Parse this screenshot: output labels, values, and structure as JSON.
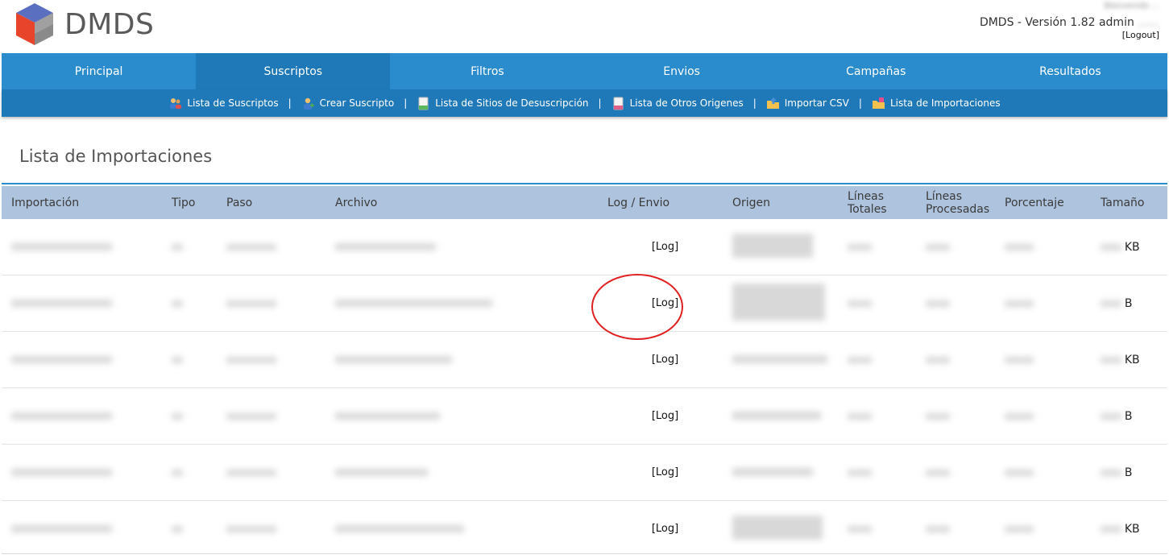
{
  "header": {
    "logo_text": "DMDS",
    "user_top": "Bienvenido ...",
    "version_label": "DMDS - Versión 1.82 admin",
    "version_user": "......",
    "logout_label": "[Logout]"
  },
  "main_nav": {
    "tabs": [
      {
        "label": "Principal"
      },
      {
        "label": "Suscriptos"
      },
      {
        "label": "Filtros"
      },
      {
        "label": "Envios"
      },
      {
        "label": "Campañas"
      },
      {
        "label": "Resultados"
      }
    ],
    "active_tab": "Suscriptos"
  },
  "sub_nav": {
    "items": [
      {
        "label": "Lista de Suscriptos",
        "icon": "users-icon"
      },
      {
        "label": "Crear Suscripto",
        "icon": "add-user-icon"
      },
      {
        "label": "Lista de Sitios de Desuscripción",
        "icon": "document-icon"
      },
      {
        "label": "Lista de Otros Origenes",
        "icon": "document-pink-icon"
      },
      {
        "label": "Importar CSV",
        "icon": "folder-import-icon"
      },
      {
        "label": "Lista de Importaciones",
        "icon": "folder-list-icon"
      }
    ],
    "separator": "|"
  },
  "page": {
    "title": "Lista de Importaciones"
  },
  "table": {
    "headers": {
      "importacion": "Importación",
      "tipo": "Tipo",
      "paso": "Paso",
      "archivo": "Archivo",
      "log": "Log / Envio",
      "origen": "Origen",
      "lineas_totales_1": "Líneas",
      "lineas_totales_2": "Totales",
      "lineas_procesadas_1": "Líneas",
      "lineas_procesadas_2": "Procesadas",
      "porcentaje": "Porcentaje",
      "tamano": "Tamaño"
    },
    "rows": [
      {
        "log": "[Log]",
        "unit": "KB"
      },
      {
        "log": "[Log]",
        "unit": "B"
      },
      {
        "log": "[Log]",
        "unit": "KB"
      },
      {
        "log": "[Log]",
        "unit": "B"
      },
      {
        "log": "[Log]",
        "unit": "B"
      },
      {
        "log": "[Log]",
        "unit": "KB"
      }
    ]
  },
  "colors": {
    "nav_blue": "#2b8ccd",
    "nav_active": "#1f78b7",
    "header_row": "#aec4de",
    "annotation": "#e02020"
  }
}
